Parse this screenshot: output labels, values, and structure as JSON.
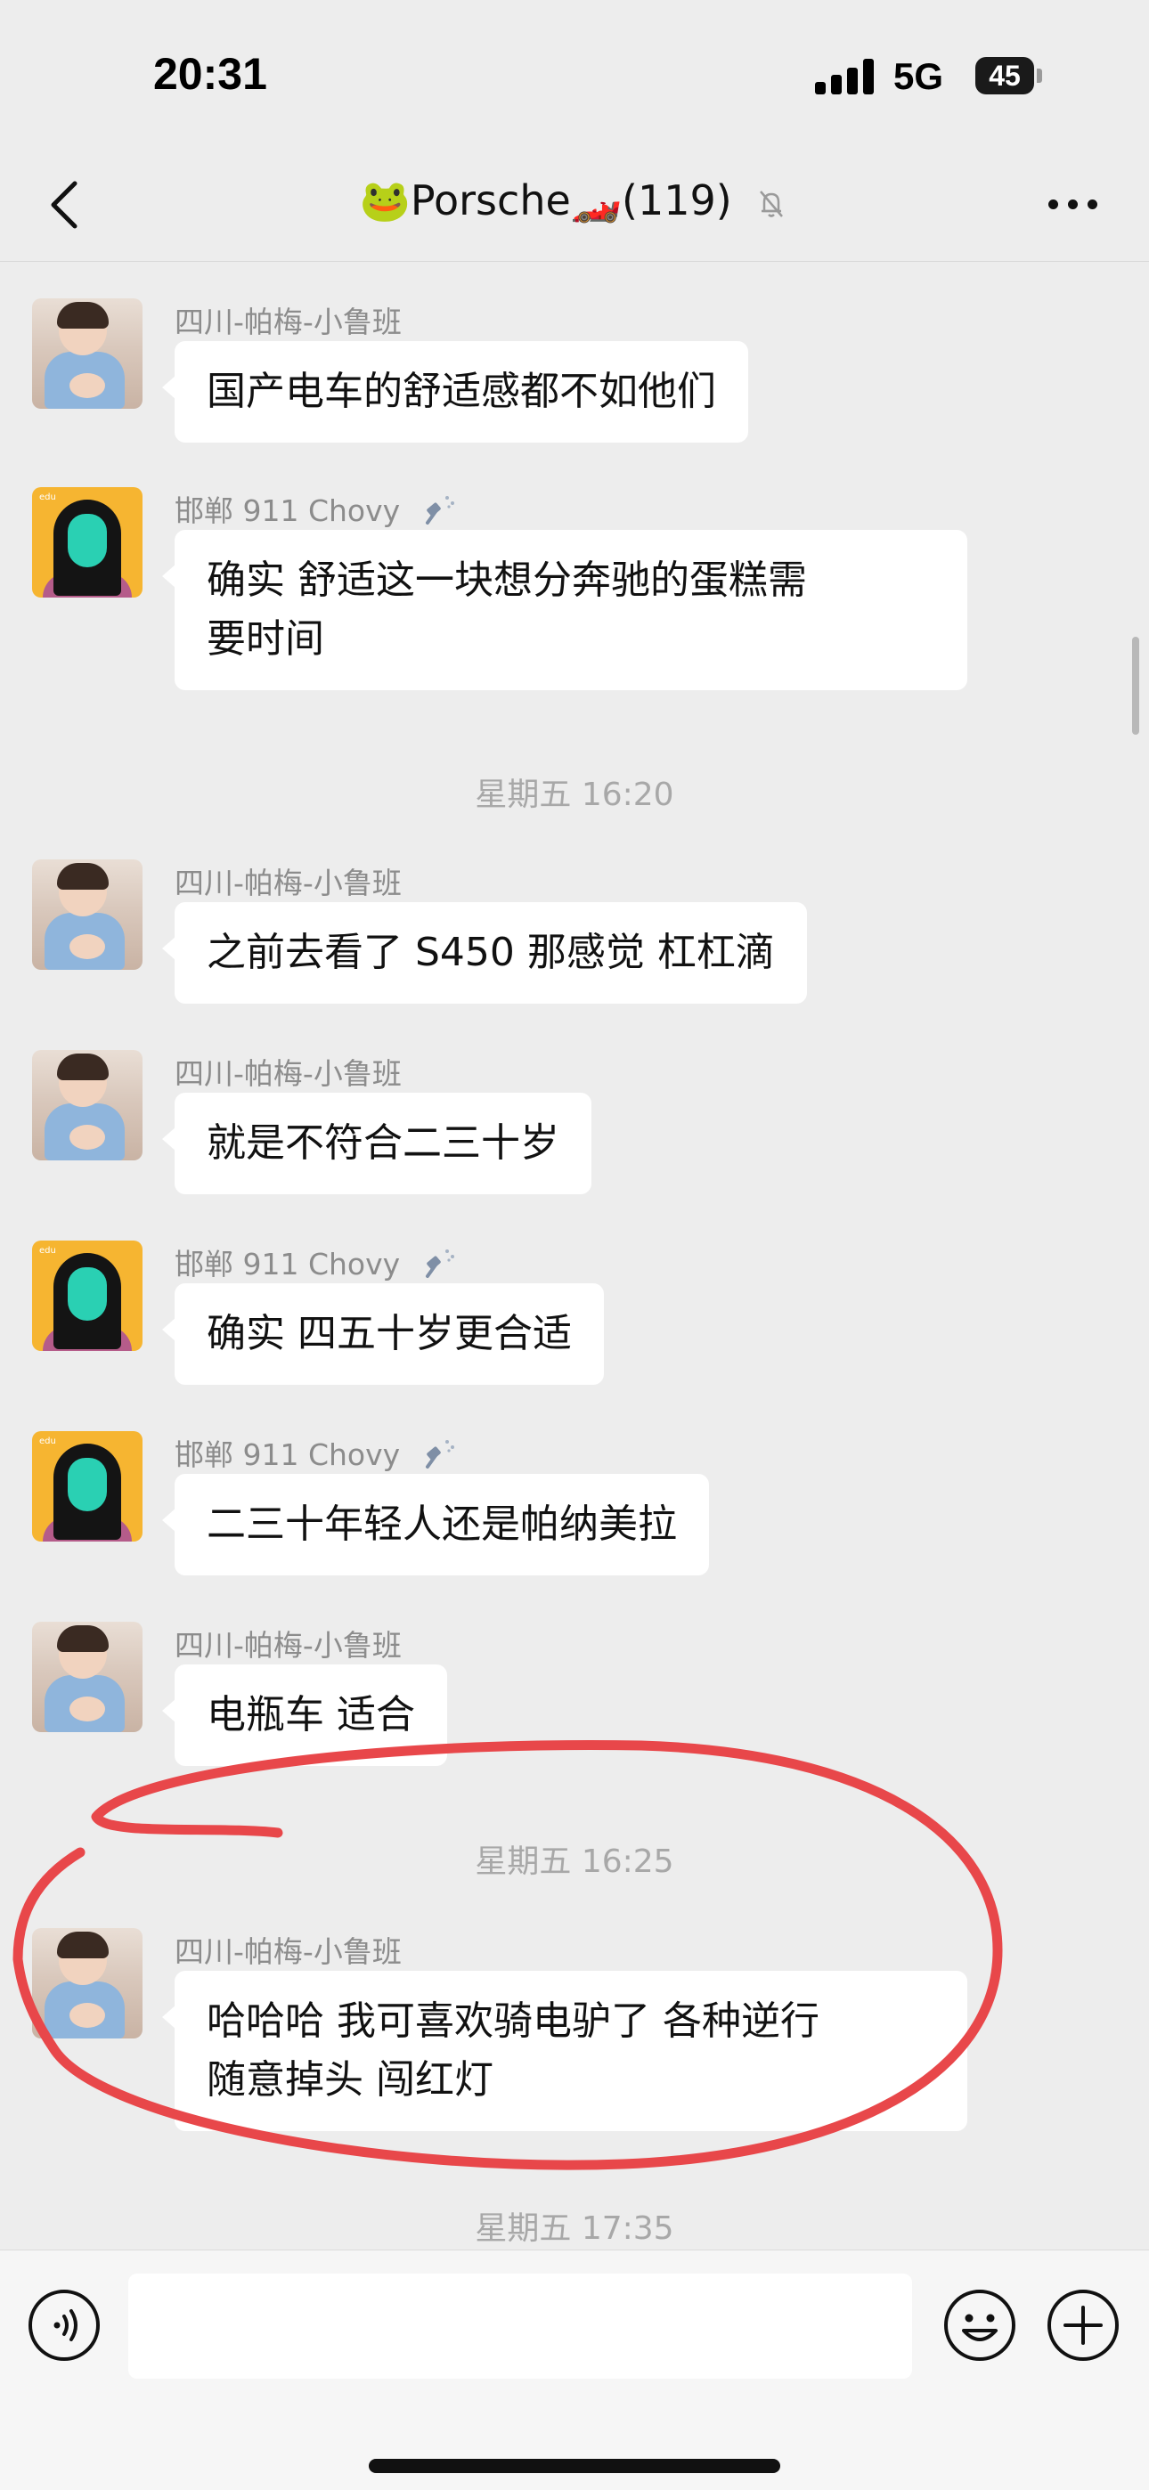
{
  "status_bar": {
    "time": "20:31",
    "network": "5G",
    "battery": "45"
  },
  "nav": {
    "title": "🐸Porsche🏎️(119)",
    "icons": {
      "back": "chevron-left-icon",
      "mute": "bell-slash-icon",
      "more": "more-dots-icon"
    }
  },
  "messages": [
    {
      "sender": "四川-帕梅-小鲁班",
      "text": "国产电车的舒适感都不如他们"
    },
    {
      "sender": "邯郸  911  Chovy",
      "text": "确实   舒适这一块想分奔驰的蛋糕需",
      "text2": "要时间"
    },
    {
      "timestamp": "星期五 16:20"
    },
    {
      "sender": "四川-帕梅-小鲁班",
      "text": "之前去看了 S450 那感觉 杠杠滴"
    },
    {
      "sender": "四川-帕梅-小鲁班",
      "text": "就是不符合二三十岁"
    },
    {
      "sender": "邯郸  911  Chovy",
      "text": "确实  四五十岁更合适"
    },
    {
      "sender": "邯郸  911  Chovy",
      "text": "二三十年轻人还是帕纳美拉"
    },
    {
      "sender": "四川-帕梅-小鲁班",
      "text": "电瓶车 适合"
    },
    {
      "timestamp": "星期五 16:25"
    },
    {
      "sender": "四川-帕梅-小鲁班",
      "text": "哈哈哈 我可喜欢骑电驴了 各种逆行",
      "text2": "随意掉头 闯红灯"
    },
    {
      "timestamp": "星期五 17:35"
    }
  ],
  "input": {
    "placeholder": "",
    "icons": {
      "voice": "voice-icon",
      "emoji": "emoji-icon",
      "plus": "plus-icon"
    }
  },
  "colors": {
    "background": "#ededed",
    "bubble": "#ffffff",
    "annotation": "#e8474a"
  }
}
